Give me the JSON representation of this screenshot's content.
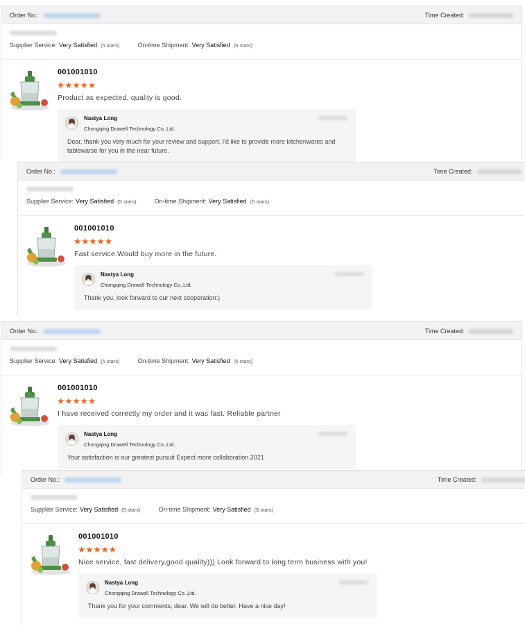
{
  "labels": {
    "order_no": "Order No.:",
    "time_created": "Time Created:",
    "supplier_service": "Supplier Service:",
    "on_time_shipment": "On-time Shipment:",
    "very_satisfied": "Very Satisfied",
    "five_stars": "(5 stars)"
  },
  "colors": {
    "star": "#f0641f",
    "header_bg": "#f2f2f2",
    "reply_bg": "#f5f5f5"
  },
  "reviews": [
    {
      "product_id": "001001010",
      "rating": 5,
      "stars": "★★★★★",
      "text": "Product as expected, quality is good.",
      "reply": {
        "name": "Nastya Long",
        "company": "Chongqing Drawell Technology Co.,Ltd.",
        "text": "Dear, thank you very much for your review and support, I'd like to provide more kitchenwares and tablewarse for you in the near future."
      }
    },
    {
      "product_id": "001001010",
      "rating": 5,
      "stars": "★★★★★",
      "text": "Fast service.Would buy more in the future.",
      "reply": {
        "name": "Nastya Long",
        "company": "Chongqing Drawell Technology Co.,Ltd.",
        "text": "Thank you, look forward to our next cooperation:)"
      }
    },
    {
      "product_id": "001001010",
      "rating": 5,
      "stars": "★★★★★",
      "text": "I have received correctly my order and it was fast. Reliable partner",
      "reply": {
        "name": "Nastya Long",
        "company": "Chongqing Drawell Technology Co.,Ltd.",
        "text": "Your satisfaction is our greatest pursuit Expect more collaboration 2021"
      }
    },
    {
      "product_id": "001001010",
      "rating": 5,
      "stars": "★★★★★",
      "text": "Nice service, fast delivery,good quality))) Look forward to long term business with you!",
      "reply": {
        "name": "Nastya Long",
        "company": "Chongqing Drawell Technology Co.,Ltd.",
        "text": "Thank you for your comments, dear. We will do better. Have a nice day!"
      }
    }
  ]
}
